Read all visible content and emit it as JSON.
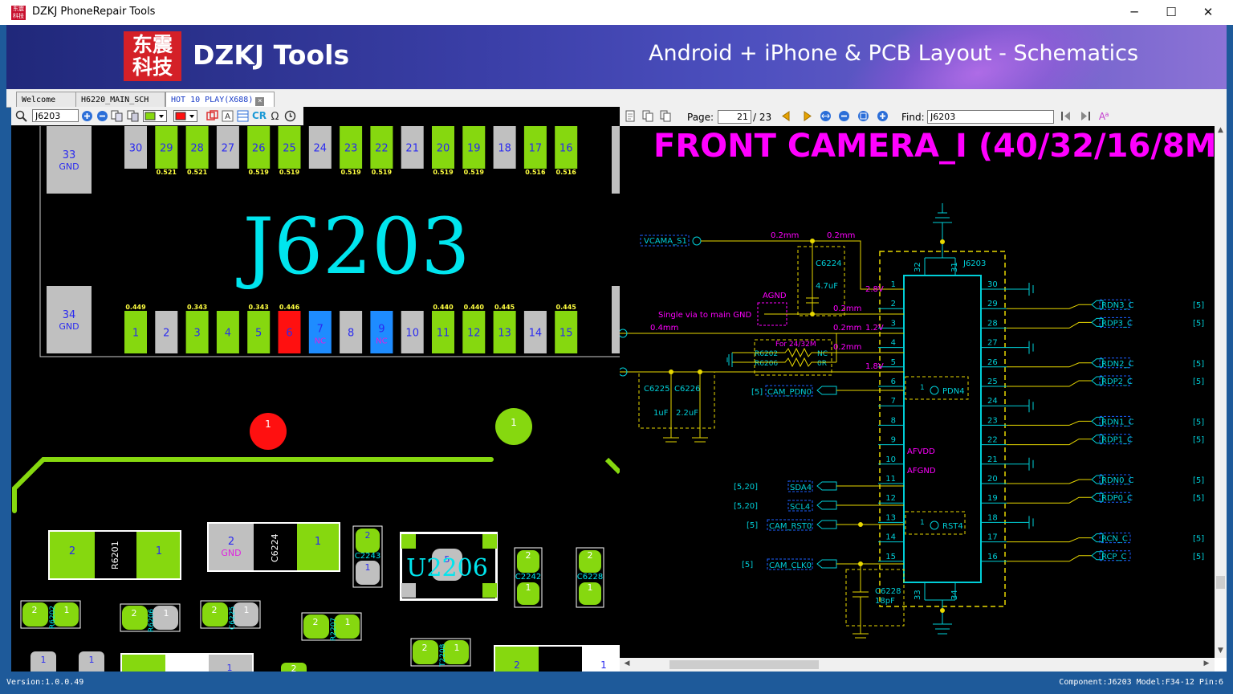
{
  "window": {
    "title": "DZKJ PhoneRepair Tools",
    "minimize": "─",
    "maximize": "☐",
    "close": "✕"
  },
  "banner": {
    "logo_line1": "东震",
    "logo_line2": "科技",
    "brand": "DZKJ Tools",
    "tagline": "Android + iPhone & PCB Layout - Schematics"
  },
  "tabs": [
    {
      "label": "Welcome",
      "active": false
    },
    {
      "label": "H6220_MAIN_SCH",
      "active": false
    },
    {
      "label": "HOT 10 PLAY(X688)",
      "active": true
    }
  ],
  "left_toolbar": {
    "search_value": "J6203",
    "cr_label": "CR"
  },
  "pcb": {
    "component_label": "J6203",
    "top_pins": [
      {
        "num": "33",
        "sub": "GND",
        "color": "gray",
        "value": ""
      },
      {
        "num": "30",
        "color": "gray",
        "value": ""
      },
      {
        "num": "29",
        "color": "green",
        "value": "0.521"
      },
      {
        "num": "28",
        "color": "green",
        "value": "0.521"
      },
      {
        "num": "27",
        "color": "gray",
        "value": ""
      },
      {
        "num": "26",
        "color": "green",
        "value": "0.519"
      },
      {
        "num": "25",
        "color": "green",
        "value": "0.519"
      },
      {
        "num": "24",
        "color": "gray",
        "value": ""
      },
      {
        "num": "23",
        "color": "green",
        "value": "0.519"
      },
      {
        "num": "22",
        "color": "green",
        "value": "0.519"
      },
      {
        "num": "21",
        "color": "gray",
        "value": ""
      },
      {
        "num": "20",
        "color": "green",
        "value": "0.519"
      },
      {
        "num": "19",
        "color": "green",
        "value": "0.519"
      },
      {
        "num": "18",
        "color": "gray",
        "value": ""
      },
      {
        "num": "17",
        "color": "green",
        "value": "0.516"
      },
      {
        "num": "16",
        "color": "green",
        "value": "0.516"
      }
    ],
    "bottom_pins": [
      {
        "num": "34",
        "sub": "GND",
        "color": "gray",
        "value": ""
      },
      {
        "num": "1",
        "color": "green",
        "value": "0.449"
      },
      {
        "num": "2",
        "color": "gray",
        "value": ""
      },
      {
        "num": "3",
        "color": "green",
        "value": "0.343"
      },
      {
        "num": "4",
        "color": "green",
        "value": ""
      },
      {
        "num": "5",
        "color": "green",
        "value": "0.343"
      },
      {
        "num": "6",
        "color": "red",
        "value": "0.446"
      },
      {
        "num": "7",
        "sub": "NC",
        "color": "blue",
        "value": ""
      },
      {
        "num": "8",
        "color": "gray",
        "value": ""
      },
      {
        "num": "9",
        "sub": "NC",
        "color": "blue",
        "value": ""
      },
      {
        "num": "10",
        "color": "gray",
        "value": ""
      },
      {
        "num": "11",
        "color": "green",
        "value": "0.440"
      },
      {
        "num": "12",
        "color": "green",
        "value": "0.440"
      },
      {
        "num": "13",
        "color": "green",
        "value": "0.445"
      },
      {
        "num": "14",
        "color": "gray",
        "value": ""
      },
      {
        "num": "15",
        "color": "green",
        "value": "0.445"
      }
    ],
    "test_points": [
      "1",
      "1"
    ],
    "parts": {
      "r6201": "R6201",
      "c6224": "C6224",
      "c2243": "C2243",
      "u2206": "U2206",
      "c2242": "C2242",
      "c6228": "C6228",
      "r6202": "R6202",
      "r6206": "R6206",
      "c6225": "C6225",
      "r2207": "R2207",
      "t2208": "T2208",
      "gnd": "GND",
      "n1": "1",
      "n2": "2",
      "n5": "5"
    }
  },
  "right_toolbar": {
    "page_label": "Page:",
    "page_value": "21",
    "page_total": "/ 23",
    "find_label": "Find:",
    "find_value": "J6203"
  },
  "schematic": {
    "title": "FRONT CAMERA_I (40/32/16/8M",
    "refdes": "J6203",
    "net_vcama": "VCAMA_S1",
    "w02a": "0.2mm",
    "w02b": "0.2mm",
    "w02c": "0.2mm",
    "w02d": "0.2mm",
    "w02e": "0.2mm",
    "w04": "0.4mm",
    "v28": "2.8V",
    "v12": "1.2V",
    "v18": "1.8V",
    "c6224": "C6224",
    "c6224_val": "4.7uF",
    "agnd": "AGND",
    "single_via": "Single via to main GND",
    "for_note": "For 24/32M",
    "r6202": "R6202",
    "r6206": "R6206",
    "nc": "NC",
    "zero": "0R",
    "c6225": "C6225",
    "c6225_val": "1uF",
    "c6226": "C6226",
    "c6226_val": "2.2uF",
    "cam_pdn": "CAM_PDN0",
    "ref5": "[5]",
    "ref520": "[5,20]",
    "sda": "SDA4",
    "scl": "SCL4",
    "cam_rst": "CAM_RST0",
    "cam_clk": "CAM_CLK0",
    "pdn4": "PDN4",
    "rst4": "RST4",
    "afvdd": "AFVDD",
    "afgnd": "AFGND",
    "one": "1",
    "c6228": "C6228",
    "c6228_val": "18pF",
    "left_pins": [
      "1",
      "2",
      "3",
      "4",
      "5",
      "6",
      "7",
      "8",
      "9",
      "10",
      "11",
      "12",
      "13",
      "14",
      "15"
    ],
    "right_pins": [
      "30",
      "29",
      "28",
      "27",
      "26",
      "25",
      "24",
      "23",
      "22",
      "21",
      "20",
      "19",
      "18",
      "17",
      "16"
    ],
    "top_pins": [
      "32",
      "31"
    ],
    "bottom_pins": [
      "33",
      "34"
    ],
    "diff_nets": [
      "RDN3_C",
      "RDP3_C",
      "RDN2_C",
      "RDP2_C",
      "RDN1_C",
      "RDP1_C",
      "RDN0_C",
      "RDP0_C",
      "RCN_C",
      "RCP_C"
    ]
  },
  "status": {
    "version": "Version:1.0.0.49",
    "component_info": "Component:J6203 Model:F34-12 Pin:6"
  }
}
